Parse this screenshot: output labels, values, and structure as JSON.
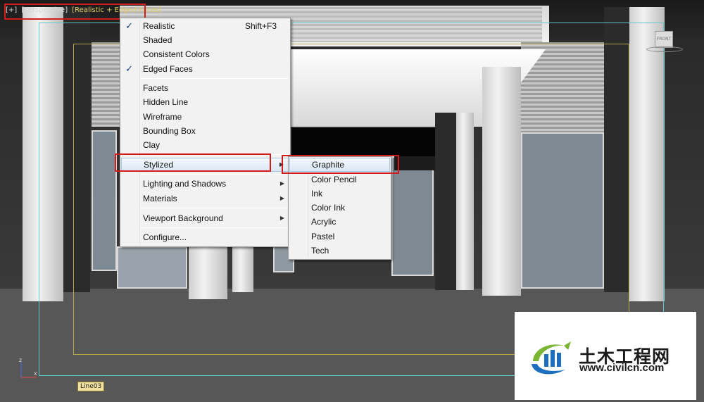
{
  "viewport": {
    "label_plus": "[+]",
    "label_view": "[Perspective]",
    "label_shading": "[Realistic + Edged Faces]",
    "viewcube_label": "FRONT",
    "axis_x": "x",
    "axis_z": "z",
    "selected_object": "Line03"
  },
  "main_menu": {
    "items": [
      {
        "label": "Realistic",
        "checked": true,
        "shortcut": "Shift+F3"
      },
      {
        "label": "Shaded"
      },
      {
        "label": "Consistent Colors"
      },
      {
        "label": "Edged Faces",
        "checked": true
      },
      {
        "label": "Facets"
      },
      {
        "label": "Hidden Line"
      },
      {
        "label": "Wireframe"
      },
      {
        "label": "Bounding Box"
      },
      {
        "label": "Clay"
      },
      {
        "label": "Stylized",
        "submenu": true,
        "highlighted": true
      },
      {
        "label": "Lighting and Shadows",
        "submenu": true
      },
      {
        "label": "Materials",
        "submenu": true
      },
      {
        "label": "Viewport Background",
        "submenu": true
      },
      {
        "label": "Configure..."
      }
    ]
  },
  "sub_menu": {
    "items": [
      {
        "label": "Graphite",
        "highlighted": true
      },
      {
        "label": "Color Pencil"
      },
      {
        "label": "Ink"
      },
      {
        "label": "Color Ink"
      },
      {
        "label": "Acrylic"
      },
      {
        "label": "Pastel"
      },
      {
        "label": "Tech"
      }
    ]
  },
  "watermark": {
    "title": "土木工程网",
    "url": "www.civilcn.com"
  },
  "colors": {
    "highlight_box": "#d01c1c",
    "label_yellow": "#e2c85f",
    "menu_bg": "#f2f2f2",
    "check_color": "#1b3b7a",
    "logo_blue": "#1e6fc0",
    "logo_green": "#7bb534"
  },
  "icons": [
    "check-icon",
    "submenu-arrow-icon",
    "viewcube-icon",
    "axis-gizmo-icon",
    "civilcn-logo-icon"
  ]
}
